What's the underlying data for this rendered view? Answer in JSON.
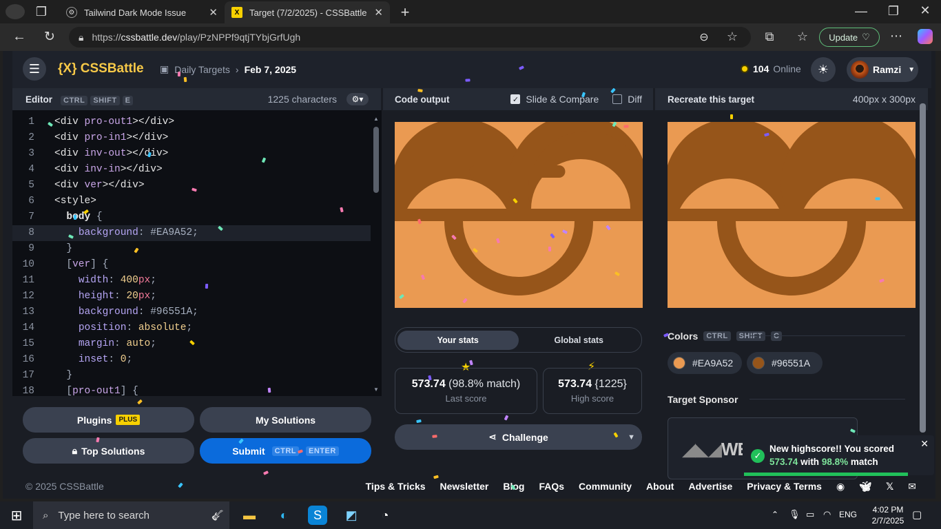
{
  "browser": {
    "tabs": [
      {
        "title": "Tailwind Dark Mode Issue"
      },
      {
        "title": "Target (7/2/2025) - CSSBattle"
      }
    ],
    "url_prefix": "https://",
    "url_host": "cssbattle.dev",
    "url_path": "/play/PzNPPf9qtjTYbjGrfUgh",
    "update_label": "Update"
  },
  "header": {
    "logo": "{X} CSSBattle",
    "breadcrumb_parent": "Daily Targets",
    "breadcrumb_current": "Feb 7, 2025",
    "online_count": "104",
    "online_label": "Online",
    "username": "Ramzi"
  },
  "editor": {
    "title": "Editor",
    "shortcut": [
      "CTRL",
      "SHIFT",
      "E"
    ],
    "chars": "1225 characters",
    "lines": [
      {
        "n": "1",
        "html": "<span class='t-tag'>&lt;div </span><span class='t-attr'>pro-out1</span><span class='t-tag'>&gt;&lt;/div&gt;</span>"
      },
      {
        "n": "2",
        "html": "<span class='t-tag'>&lt;div </span><span class='t-attr'>pro-in1</span><span class='t-tag'>&gt;&lt;/div&gt;</span>"
      },
      {
        "n": "3",
        "html": "<span class='t-tag'>&lt;div </span><span class='t-attr'>inv-out</span><span class='t-tag'>&gt;&lt;/div&gt;</span>"
      },
      {
        "n": "4",
        "html": "<span class='t-tag'>&lt;div </span><span class='t-attr'>inv-in</span><span class='t-tag'>&gt;&lt;/div&gt;</span>"
      },
      {
        "n": "5",
        "html": "<span class='t-tag'>&lt;div </span><span class='t-attr'>ver</span><span class='t-tag'>&gt;&lt;/div&gt;</span>"
      },
      {
        "n": "6",
        "html": "<span class='t-tag'>&lt;style&gt;</span>"
      },
      {
        "n": "7",
        "html": "  <span class='t-sel'>body</span> <span class='t-str'>{</span>"
      },
      {
        "n": "8",
        "html": "    <span class='t-prop'>background</span><span class='t-str'>: </span><span class='t-str'>#EA9A52</span><span class='t-str'>;</span>"
      },
      {
        "n": "9",
        "html": "  <span class='t-str'>}</span>"
      },
      {
        "n": "10",
        "html": "  <span class='t-str'>[</span><span class='t-attr'>ver</span><span class='t-str'>] {</span>"
      },
      {
        "n": "11",
        "html": "    <span class='t-prop'>width</span><span class='t-str'>: </span><span class='t-val'>400</span><span class='t-unit'>px</span><span class='t-str'>;</span>"
      },
      {
        "n": "12",
        "html": "    <span class='t-prop'>height</span><span class='t-str'>: </span><span class='t-val'>20</span><span class='t-unit'>px</span><span class='t-str'>;</span>"
      },
      {
        "n": "13",
        "html": "    <span class='t-prop'>background</span><span class='t-str'>: #96551A;</span>"
      },
      {
        "n": "14",
        "html": "    <span class='t-prop'>position</span><span class='t-str'>: </span><span class='t-val'>absolute</span><span class='t-str'>;</span>"
      },
      {
        "n": "15",
        "html": "    <span class='t-prop'>margin</span><span class='t-str'>: </span><span class='t-val'>auto</span><span class='t-str'>;</span>"
      },
      {
        "n": "16",
        "html": "    <span class='t-prop'>inset</span><span class='t-str'>: </span><span class='t-val'>0</span><span class='t-str'>;</span>"
      },
      {
        "n": "17",
        "html": "  <span class='t-str'>}</span>"
      },
      {
        "n": "18",
        "html": "  <span class='t-str'>[</span><span class='t-attr'>pro-out1</span><span class='t-str'>] {</span>"
      }
    ]
  },
  "buttons": {
    "plugins": "Plugins",
    "plus_badge": "PLUS",
    "my_solutions": "My Solutions",
    "top_solutions": "Top Solutions",
    "submit": "Submit",
    "submit_shortcut": [
      "CTRL",
      "ENTER"
    ]
  },
  "output": {
    "title": "Code output",
    "slide_compare": "Slide & Compare",
    "diff": "Diff"
  },
  "target": {
    "title": "Recreate this target",
    "size": "400px x 300px"
  },
  "stats": {
    "tab_yours": "Your stats",
    "tab_global": "Global stats",
    "last_score": "573.74",
    "last_match": "(98.8% match)",
    "last_label": "Last score",
    "high_score": "573.74",
    "high_chars": "{1225}",
    "high_label": "High score",
    "challenge": "Challenge"
  },
  "colors": {
    "label": "Colors",
    "shortcut": [
      "CTRL",
      "SHIFT",
      "C"
    ],
    "swatches": [
      {
        "hex": "#EA9A52"
      },
      {
        "hex": "#96551A"
      }
    ]
  },
  "sponsor": {
    "label": "Target Sponsor",
    "logo_text": "WE"
  },
  "toast": {
    "line1": "New highscore!! You scored",
    "score": "573.74",
    "with": "with",
    "match": "98.8%",
    "match_word": "match"
  },
  "footer": {
    "copyright": "© 2025 CSSBattle",
    "links": [
      "Tips & Tricks",
      "Newsletter",
      "Blog",
      "FAQs",
      "Community",
      "About",
      "Advertise",
      "Privacy & Terms"
    ]
  },
  "taskbar": {
    "search_placeholder": "Type here to search",
    "lang": "ENG",
    "time": "4:02 PM",
    "date": "2/7/2025"
  }
}
